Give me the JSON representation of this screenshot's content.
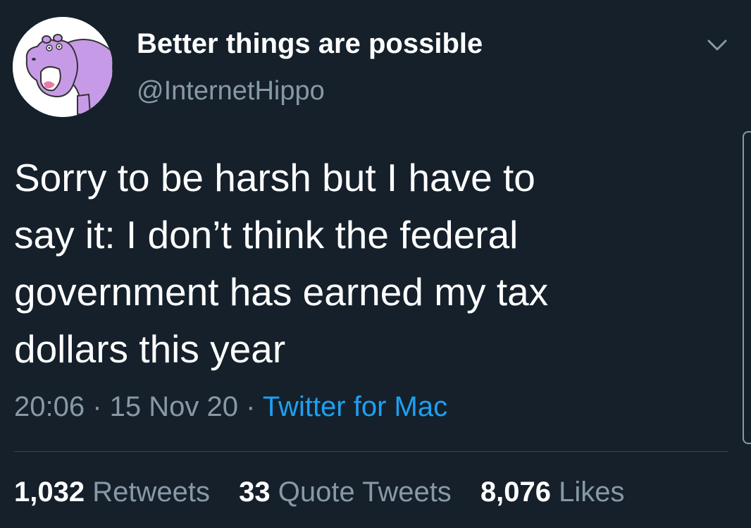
{
  "header": {
    "avatar_icon": "hippo-avatar-icon",
    "display_name": "Better things are possible",
    "handle": "@InternetHippo",
    "menu_icon": "chevron-down-icon"
  },
  "tweet": {
    "text_lines": [
      "Sorry to be harsh but I have to",
      "say it: I don’t think the federal",
      "government has earned my tax",
      "dollars this year"
    ],
    "time": "20:06",
    "separator": " · ",
    "date": "15 Nov 20",
    "source": "Twitter for Mac"
  },
  "stats": {
    "retweets": {
      "count": "1,032",
      "label": "Retweets"
    },
    "quote_tweets": {
      "count": "33",
      "label": "Quote Tweets"
    },
    "likes": {
      "count": "8,076",
      "label": "Likes"
    }
  },
  "colors": {
    "background": "#15202b",
    "primary_text": "#ffffff",
    "secondary_text": "#8899a6",
    "link": "#1da1f2",
    "avatar_hippo": "#c79ae8"
  }
}
